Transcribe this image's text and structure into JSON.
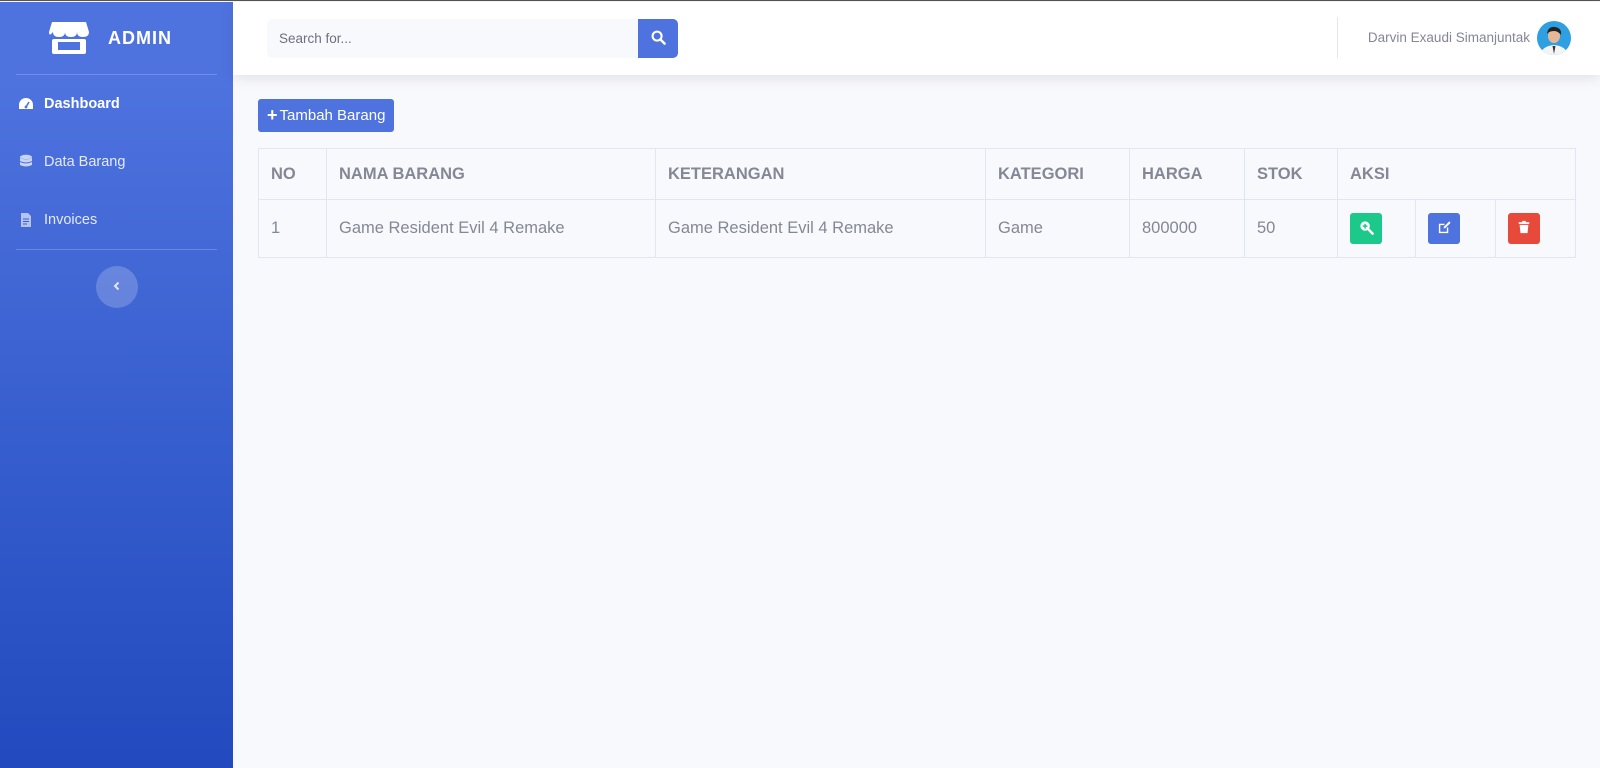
{
  "brand": {
    "title": "ADMIN",
    "icon": "store-icon"
  },
  "sidebar": {
    "items": [
      {
        "label": "Dashboard",
        "icon": "tachometer-icon",
        "active": true
      },
      {
        "label": "Data Barang",
        "icon": "database-icon",
        "active": false
      },
      {
        "label": "Invoices",
        "icon": "file-icon",
        "active": false
      }
    ]
  },
  "topbar": {
    "search_placeholder": "Search for...",
    "user_name": "Darvin Exaudi Simanjuntak"
  },
  "main": {
    "add_button_label": "Tambah Barang",
    "table": {
      "headers": [
        "NO",
        "NAMA BARANG",
        "KETERANGAN",
        "KATEGORI",
        "HARGA",
        "STOK",
        "AKSI"
      ],
      "rows": [
        {
          "no": "1",
          "nama": "Game Resident Evil 4 Remake",
          "keterangan": "Game Resident Evil 4 Remake",
          "kategori": "Game",
          "harga": "800000",
          "stok": "50"
        }
      ]
    }
  },
  "colors": {
    "primary": "#4e73df",
    "success": "#1cc88a",
    "danger": "#e74a3b",
    "text_muted": "#858796"
  }
}
